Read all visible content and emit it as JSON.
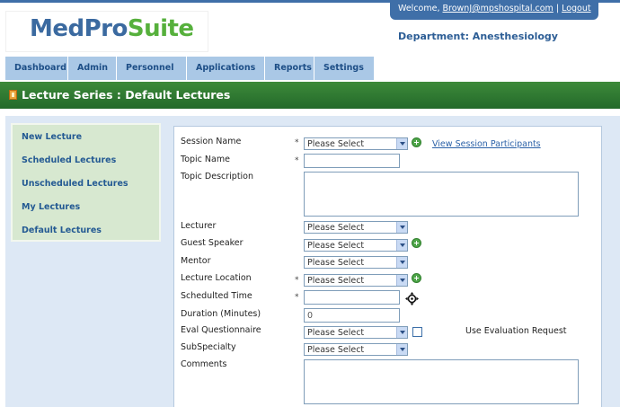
{
  "header": {
    "logo_part1": "MedPro",
    "logo_part2": "Suite",
    "welcome_prefix": "Welcome,",
    "user_email": "BrownJ@mpshospital.com",
    "separator": "|",
    "logout_label": "Logout",
    "department": "Department: Anesthesiology"
  },
  "nav": {
    "tabs": [
      "Dashboard",
      "Admin",
      "Personnel",
      "Applications",
      "Reports",
      "Settings"
    ]
  },
  "page_title": "Lecture Series : Default Lectures",
  "sidebar": {
    "items": [
      "New Lecture",
      "Scheduled Lectures",
      "Unscheduled Lectures",
      "My Lectures",
      "Default Lectures"
    ]
  },
  "form": {
    "required_marker": "*",
    "session_name_label": "Session Name",
    "session_name_value": "Please Select",
    "view_participants_link": "View Session Participants",
    "topic_name_label": "Topic Name",
    "topic_description_label": "Topic Description",
    "lecturer_label": "Lecturer",
    "lecturer_value": "Please Select",
    "guest_speaker_label": "Guest Speaker",
    "guest_speaker_value": "Please Select",
    "mentor_label": "Mentor",
    "mentor_value": "Please Select",
    "lecture_location_label": "Lecture Location",
    "lecture_location_value": "Please Select",
    "scheduled_time_label": "Schedulted Time",
    "duration_label": "Duration (Minutes)",
    "duration_value": "0",
    "eval_questionnaire_label": "Eval Questionnaire",
    "eval_questionnaire_value": "Please Select",
    "use_evaluation_label": "Use Evaluation Request",
    "subspecialty_label": "SubSpecialty",
    "subspecialty_value": "Please Select",
    "comments_label": "Comments"
  },
  "colors": {
    "brand_blue": "#3b6aa0",
    "brand_green": "#56b03c",
    "title_bar_green": "#2e7a31",
    "nav_tab_bg": "#aac8e6"
  }
}
